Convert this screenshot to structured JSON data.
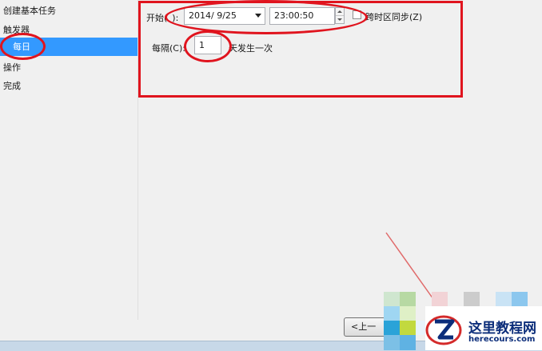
{
  "sidebar": {
    "steps": [
      {
        "label": "创建基本任务"
      },
      {
        "label": "触发器"
      },
      {
        "label": "每日"
      },
      {
        "label": "操作"
      },
      {
        "label": "完成"
      }
    ]
  },
  "trigger_form": {
    "start_label": "开始(",
    "start_label_tail": "):",
    "date_value": "2014/  9/25",
    "time_value": "23:00:50",
    "sync_timezone_label": "跨时区同步(Z)",
    "sync_timezone_checked": false,
    "recur_label": "每隔(C):",
    "recur_value": "1",
    "recur_unit": "天发生一次"
  },
  "footer": {
    "back_button_label": "<上一"
  },
  "watermark": {
    "title": "这里教程网",
    "url": "herecours.com"
  },
  "colors": {
    "selection": "#3399ff",
    "annotation": "#e0141e",
    "watermark": "#0b2d7a"
  }
}
